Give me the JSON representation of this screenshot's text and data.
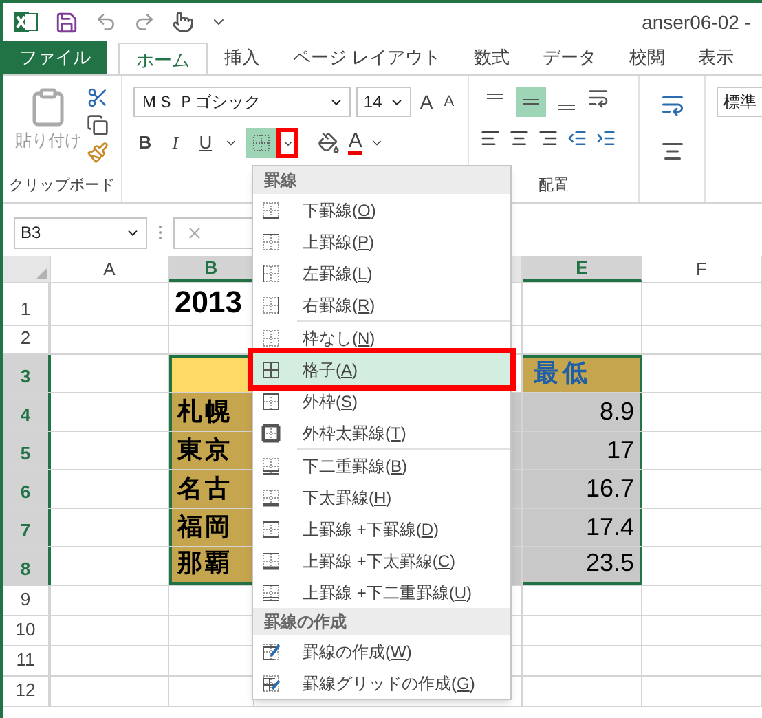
{
  "window": {
    "title": "anser06-02 -"
  },
  "tabs": [
    {
      "label": "ファイル",
      "kind": "file",
      "selected": false
    },
    {
      "label": "ホーム",
      "kind": "tab",
      "selected": true
    },
    {
      "label": "挿入",
      "kind": "tab",
      "selected": false
    },
    {
      "label": "ページ レイアウト",
      "kind": "tab",
      "selected": false
    },
    {
      "label": "数式",
      "kind": "tab",
      "selected": false
    },
    {
      "label": "データ",
      "kind": "tab",
      "selected": false
    },
    {
      "label": "校閲",
      "kind": "tab",
      "selected": false
    },
    {
      "label": "表示",
      "kind": "tab",
      "selected": false
    }
  ],
  "ribbon": {
    "paste_label": "貼り付け",
    "font_name": "ＭＳ Ｐゴシック",
    "font_size": "14",
    "grow_font": "A",
    "shrink_font": "A",
    "bold": "B",
    "italic": "I",
    "underline": "U",
    "font_color": "A",
    "number_format": "標準",
    "vertical_align": [
      {
        "selected": false
      },
      {
        "selected": true
      },
      {
        "selected": false
      }
    ],
    "groups": [
      {
        "label": "クリップボード"
      },
      {
        "label": "配置"
      }
    ]
  },
  "formula_bar": {
    "name_box": "B3"
  },
  "columns": [
    {
      "label": "A",
      "selected": false
    },
    {
      "label": "B",
      "selected": true
    },
    {
      "label": "E",
      "selected": true
    },
    {
      "label": "F",
      "selected": false
    }
  ],
  "rows": [
    {
      "header": "1",
      "selected": false,
      "b": "2013"
    },
    {
      "header": "2",
      "selected": false
    },
    {
      "header": "3",
      "selected": true,
      "e": "最低"
    },
    {
      "header": "4",
      "selected": true,
      "b": "札幌",
      "e": "8.9"
    },
    {
      "header": "5",
      "selected": true,
      "b": "東京",
      "e": "17"
    },
    {
      "header": "6",
      "selected": true,
      "b": "名古",
      "e": "16.7"
    },
    {
      "header": "7",
      "selected": true,
      "b": "福岡",
      "e": "17.4"
    },
    {
      "header": "8",
      "selected": true,
      "b": "那覇",
      "e": "23.5"
    },
    {
      "header": "9",
      "selected": false
    },
    {
      "header": "10",
      "selected": false
    },
    {
      "header": "11",
      "selected": false
    },
    {
      "header": "12",
      "selected": false
    }
  ],
  "border_menu": {
    "sections": [
      {
        "title": "罫線",
        "groups": [
          [
            {
              "label": "下罫線(O)",
              "kind": "bottom",
              "selected": false
            },
            {
              "label": "上罫線(P)",
              "kind": "top",
              "selected": false
            },
            {
              "label": "左罫線(L)",
              "kind": "left",
              "selected": false
            },
            {
              "label": "右罫線(R)",
              "kind": "right",
              "selected": false
            }
          ],
          [
            {
              "label": "枠なし(N)",
              "kind": "none",
              "selected": false
            },
            {
              "label": "格子(A)",
              "kind": "all",
              "selected": true
            },
            {
              "label": "外枠(S)",
              "kind": "outside",
              "selected": false
            },
            {
              "label": "外枠太罫線(T)",
              "kind": "thick-outside",
              "selected": false
            }
          ],
          [
            {
              "label": "下二重罫線(B)",
              "kind": "double-bottom",
              "selected": false
            },
            {
              "label": "下太罫線(H)",
              "kind": "thick-bottom",
              "selected": false
            },
            {
              "label": "上罫線 +下罫線(D)",
              "kind": "top-bottom",
              "selected": false
            },
            {
              "label": "上罫線 +下太罫線(C)",
              "kind": "top-thick-bottom",
              "selected": false
            },
            {
              "label": "上罫線 +下二重罫線(U)",
              "kind": "top-double-bottom",
              "selected": false
            }
          ]
        ]
      },
      {
        "title": "罫線の作成",
        "groups": [
          [
            {
              "label": "罫線の作成(W)",
              "kind": "draw",
              "selected": false
            },
            {
              "label": "罫線グリッドの作成(G)",
              "kind": "draw-grid",
              "selected": false
            }
          ]
        ]
      }
    ]
  }
}
